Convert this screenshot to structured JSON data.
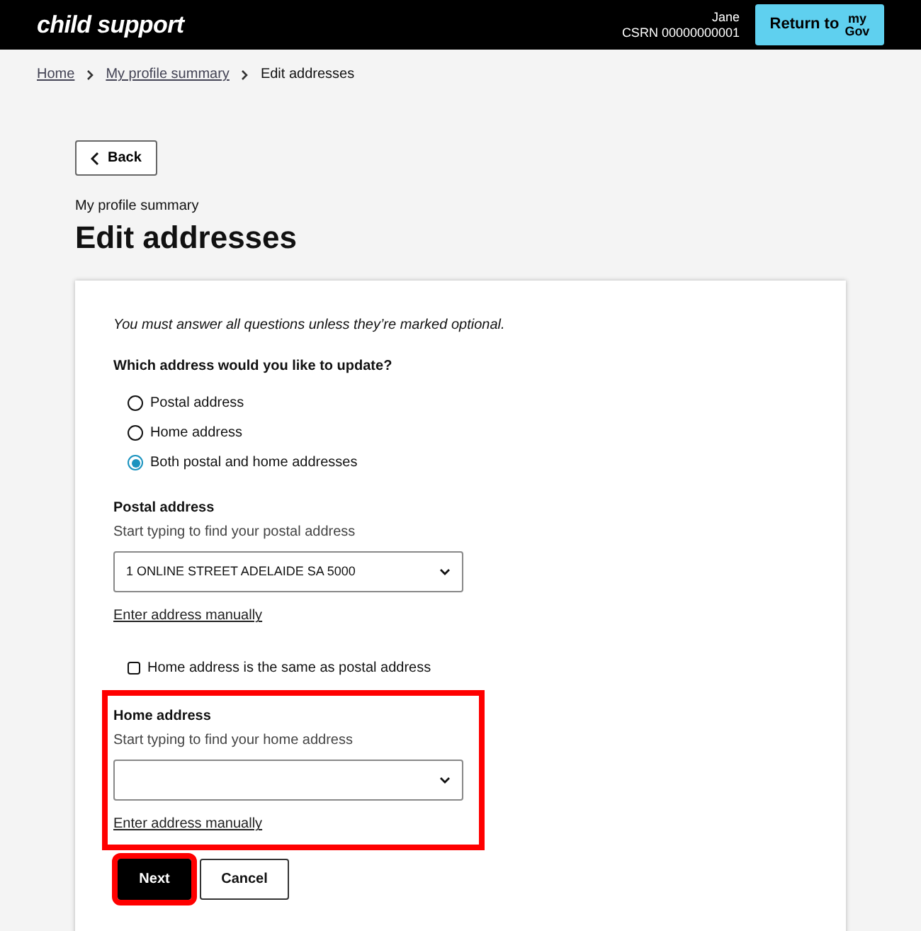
{
  "header": {
    "logo": "child support",
    "user_name": "Jane",
    "csrn": "CSRN 00000000001",
    "return_button": {
      "label": "Return to",
      "brand_top": "my",
      "brand_bottom": "Gov"
    }
  },
  "breadcrumb": [
    {
      "label": "Home",
      "link": true
    },
    {
      "label": "My profile summary",
      "link": true
    },
    {
      "label": "Edit addresses",
      "link": false
    }
  ],
  "back_button": "Back",
  "page_caption": "My profile summary",
  "page_title": "Edit addresses",
  "form": {
    "intro": "You must answer all questions unless they’re marked optional.",
    "question": "Which address would you like to update?",
    "options": [
      {
        "label": "Postal address",
        "selected": false
      },
      {
        "label": "Home address",
        "selected": false
      },
      {
        "label": "Both postal and home addresses",
        "selected": true
      }
    ],
    "sections": [
      {
        "kind": "address",
        "label": "Postal address",
        "hint": "Start typing to find your postal address",
        "value": "1 ONLINE STREET ADELAIDE SA 5000",
        "manual_link": "Enter address manually",
        "highlighted": false
      },
      {
        "kind": "checkbox",
        "label": "Home address is the same as postal address",
        "checked": false
      },
      {
        "kind": "address",
        "label": "Home address",
        "hint": "Start typing to find your home address",
        "manual_link": "Enter address manually",
        "highlighted": true
      }
    ],
    "buttons": [
      {
        "label": "Next",
        "kind": "primary",
        "highlighted": true
      },
      {
        "label": "Cancel",
        "kind": "secondary",
        "highlighted": false
      }
    ]
  }
}
